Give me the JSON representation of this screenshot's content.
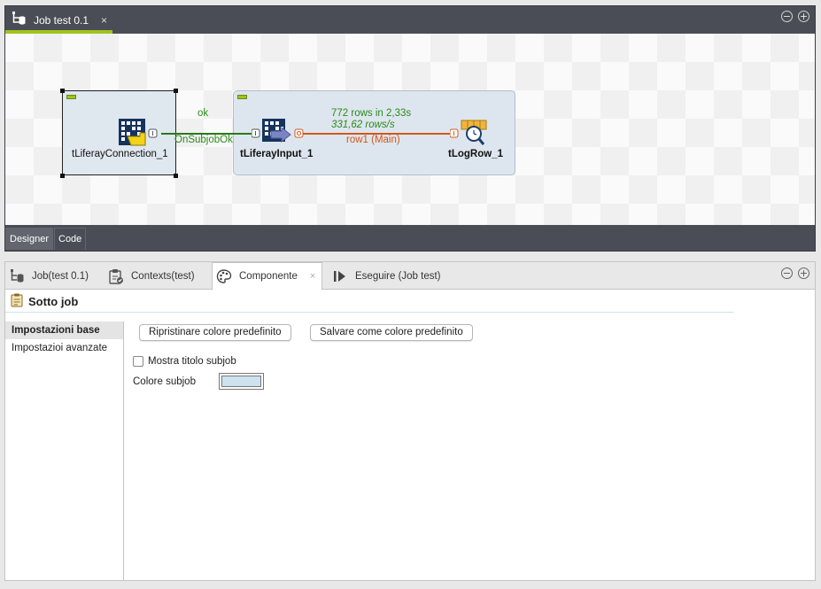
{
  "editor": {
    "tab_title": "Job test 0.1",
    "tab_close": "×",
    "minimize": "−",
    "maximize": "+",
    "modes": [
      "Designer",
      "Code"
    ]
  },
  "canvas": {
    "components": {
      "connection": "tLiferayConnection_1",
      "input": "tLiferayInput_1",
      "log": "tLogRow_1"
    },
    "links": {
      "ok": "ok",
      "on_subjob_ok": "OnSubjobOk",
      "rows_count": "772 rows in 2,33s",
      "rows_rate": "331,62 rows/s",
      "row_main": "row1 (Main)"
    },
    "colors": {
      "accent": "#9ec31d",
      "link_green": "#2a8a1a",
      "link_orange": "#d2581a"
    }
  },
  "panel": {
    "tabs": [
      {
        "label": "Job(test 0.1)"
      },
      {
        "label": "Contexts(test)"
      },
      {
        "label": "Componente"
      },
      {
        "label": "Eseguire (Job test)"
      }
    ],
    "tab_close": "×",
    "section_title": "Sotto job",
    "nav": [
      "Impostazioni base",
      "Impostazioi avanzate"
    ],
    "buttons": {
      "restore": "Ripristinare colore predefinito",
      "save": "Salvare come colore predefinito"
    },
    "checkbox_label": "Mostra titolo subjob",
    "color_label": "Colore subjob",
    "subjob_color": "#cde1ee"
  }
}
